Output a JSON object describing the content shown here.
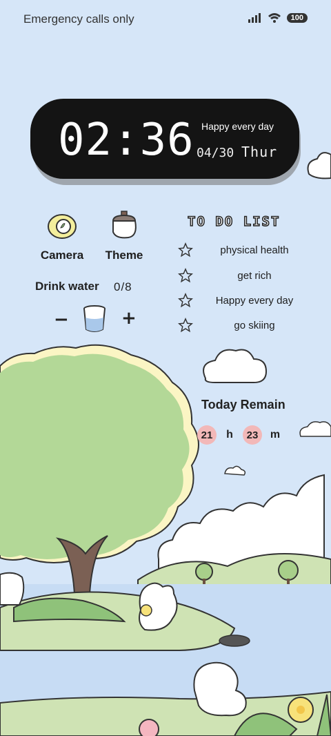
{
  "status_bar": {
    "carrier_text": "Emergency calls only",
    "battery": "100"
  },
  "clock_widget": {
    "time": "02:36",
    "motto": "Happy every day",
    "date": "04/30",
    "day": "Thur"
  },
  "shortcuts": [
    {
      "label": "Camera",
      "icon": "camera-icon"
    },
    {
      "label": "Theme",
      "icon": "theme-icon"
    }
  ],
  "drink_water": {
    "label": "Drink water",
    "count": "0/8",
    "minus": "−",
    "plus": "+"
  },
  "todo": {
    "title": "TO DO LIST",
    "items": [
      "physical health",
      "get rich",
      "Happy every day",
      "go skiing"
    ]
  },
  "today_remain": {
    "title": "Today Remain",
    "hours": "21",
    "hours_unit": "h",
    "minutes": "23",
    "minutes_unit": "m"
  },
  "colors": {
    "background": "#d6e6f8",
    "clock_bg": "#141414",
    "pill": "#f2b8b8",
    "tree": "#b3d897",
    "grass": "#cfe3b4"
  }
}
